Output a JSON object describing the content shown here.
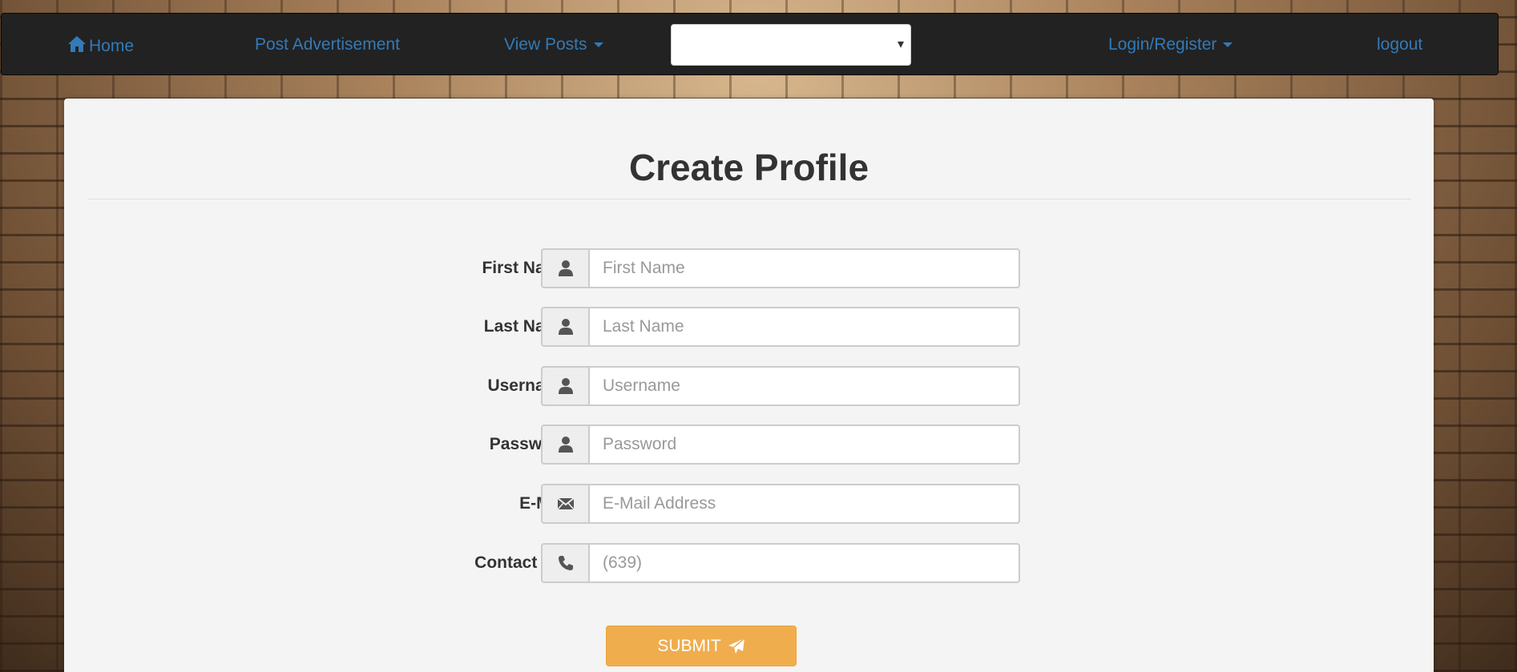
{
  "nav": {
    "home_label": "Home",
    "post_ad_label": "Post Advertisement",
    "view_posts_label": "View Posts",
    "select_value": "",
    "login_register_label": "Login/Register",
    "logout_label": "logout"
  },
  "form": {
    "title": "Create Profile",
    "fields": [
      {
        "label": "First Name",
        "placeholder": "First Name",
        "icon": "user-icon"
      },
      {
        "label": "Last Name",
        "placeholder": "Last Name",
        "icon": "user-icon"
      },
      {
        "label": "Username",
        "placeholder": "Username",
        "icon": "user-icon"
      },
      {
        "label": "Password",
        "placeholder": "Password",
        "icon": "user-icon"
      },
      {
        "label": "E-Mail",
        "placeholder": "E-Mail Address",
        "icon": "envelope-icon"
      },
      {
        "label": "Contact No.",
        "placeholder": "(639)",
        "icon": "phone-icon"
      }
    ],
    "submit_label": "SUBMIT"
  },
  "colors": {
    "navbar_bg": "#222222",
    "link": "#337ab7",
    "panel_bg": "#f4f4f4",
    "submit_bg": "#f0ad4e"
  }
}
